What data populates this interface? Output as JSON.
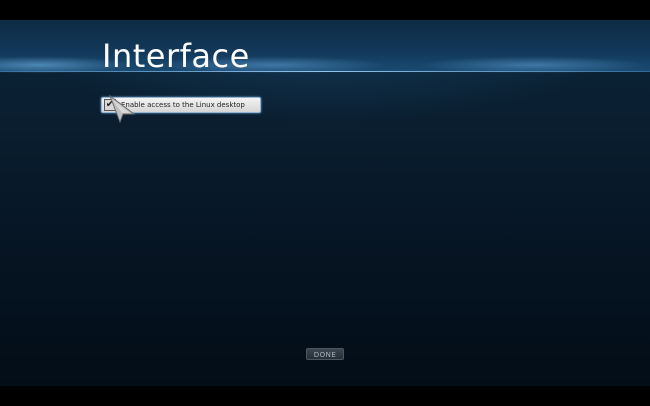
{
  "page": {
    "title": "Interface"
  },
  "options": [
    {
      "label": "Enable access to the Linux desktop",
      "checked": true,
      "check_glyph": "✔"
    }
  ],
  "footer": {
    "done_label": "DONE"
  },
  "colors": {
    "background_top": "#0b2438",
    "background_bottom": "#030d17",
    "header_highlight": "#1a4b72",
    "title_text": "#ffffff",
    "option_bg": "#e6e6e6",
    "button_bg": "#2f3a42"
  },
  "icons": {
    "checkbox": "check-icon",
    "pointer": "mouse-pointer-icon"
  }
}
